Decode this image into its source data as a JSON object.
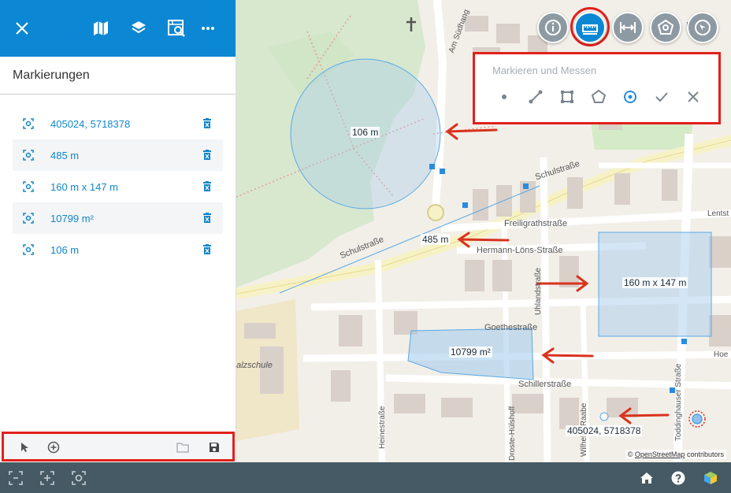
{
  "sidebar": {
    "title": "Markierungen",
    "header_icons": [
      "close-icon",
      "map-icon",
      "layers-icon",
      "map-search-icon",
      "more-icon"
    ],
    "items": [
      {
        "label": "405024, 5718378"
      },
      {
        "label": "485 m"
      },
      {
        "label": "160 m x 147 m"
      },
      {
        "label": "10799 m²"
      },
      {
        "label": "106 m"
      }
    ],
    "footer_icons": [
      "pointer-icon",
      "add-circle-icon",
      "folder-icon",
      "save-icon"
    ]
  },
  "measure_panel": {
    "title": "Markieren und Messen",
    "tools": [
      "point-icon",
      "line-icon",
      "rectangle-icon",
      "polygon-icon",
      "circle-icon",
      "check-icon",
      "close-icon"
    ]
  },
  "toolbar": {
    "buttons": [
      "info-icon",
      "measure-icon",
      "distance-icon",
      "area-icon",
      "compass-icon"
    ]
  },
  "map": {
    "labels": {
      "circle": "106 m",
      "line": "485 m",
      "rect": "160 m x 147 m",
      "polygon": "10799 m²",
      "point": "405024, 5718378"
    },
    "streets": {
      "schulstrasse1": "Schulstraße",
      "schulstrasse2": "Schulstraße",
      "freiligrath": "Freiligrathstraße",
      "hermann": "Hermann-Löns-Straße",
      "goethe": "Goethestraße",
      "schiller": "Schillerstraße",
      "am_suedhang": "Am Südhang",
      "uhland": "Uhlandstraße",
      "heine": "Heinestraße",
      "droste": "Droste-Hülshoff",
      "wilhelm": "Wilhelm-Raabe",
      "todding": "Toddinghauser Straße",
      "lents": "Lentst",
      "hoe": "Hoe",
      "schule": "alzschule"
    },
    "attribution_prefix": "©",
    "attribution_link": "OpenStreetMap",
    "attribution_suffix": "contributors",
    "colors": {
      "measure_blue": "#5aa9e6",
      "arrow_red": "#d9321f",
      "accent": "#0b87d3"
    }
  },
  "bottombar": {
    "icons": [
      "zoom-extent-icon",
      "zoom-in-icon",
      "zoom-location-icon",
      "home-icon",
      "help-icon",
      "cube-icon"
    ]
  }
}
